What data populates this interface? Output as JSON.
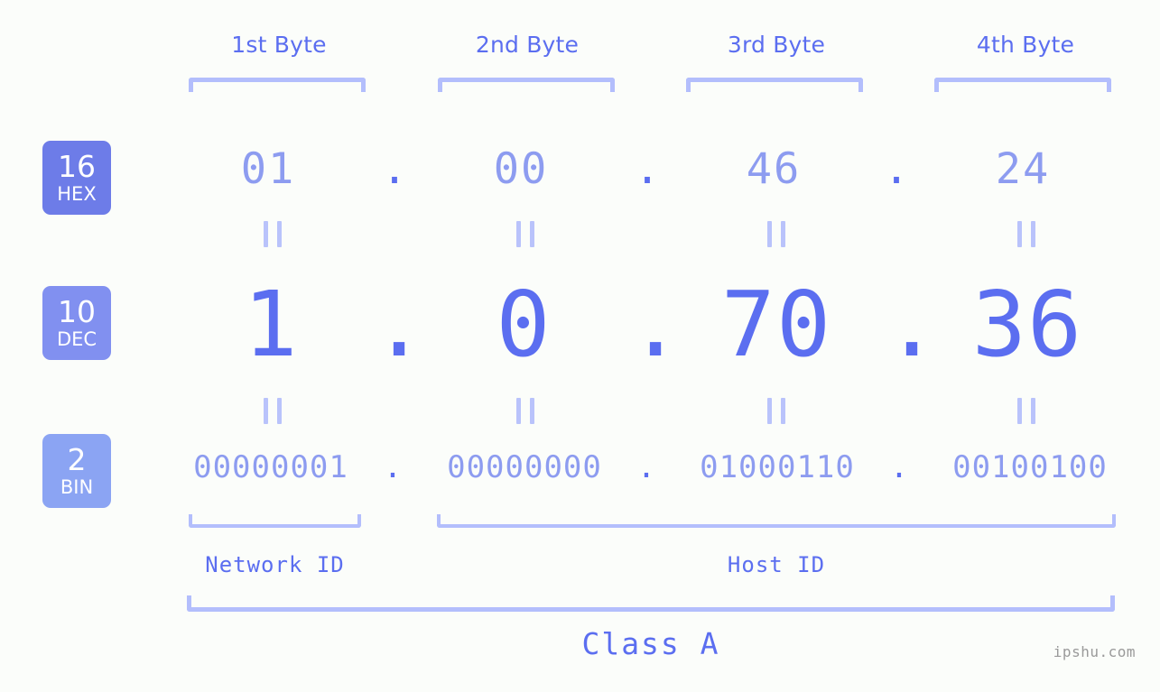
{
  "meta": {
    "background_color": "#fbfdfa",
    "accent_color": "#5b6ef0",
    "accent_light_color": "#8d9cf0",
    "bracket_color": "#b3befc"
  },
  "header": {
    "byte_labels": [
      "1st Byte",
      "2nd Byte",
      "3rd Byte",
      "4th Byte"
    ]
  },
  "bases": [
    {
      "number": "16",
      "name": "HEX",
      "color": "#6d7ce8"
    },
    {
      "number": "10",
      "name": "DEC",
      "color": "#8190f0"
    },
    {
      "number": "2",
      "name": "BIN",
      "color": "#8ba4f3"
    }
  ],
  "rows": {
    "hex": {
      "values": [
        "01",
        "00",
        "46",
        "24"
      ],
      "separator": "."
    },
    "dec": {
      "values": [
        "1",
        "0",
        "70",
        "36"
      ],
      "separator": "."
    },
    "bin": {
      "values": [
        "00000001",
        "00000000",
        "01000110",
        "00100100"
      ],
      "separator": "."
    }
  },
  "connectors": {
    "symbol": "="
  },
  "footer": {
    "network_id_label": "Network ID",
    "host_id_label": "Host ID",
    "class_label": "Class A",
    "watermark": "ipshu.com"
  }
}
